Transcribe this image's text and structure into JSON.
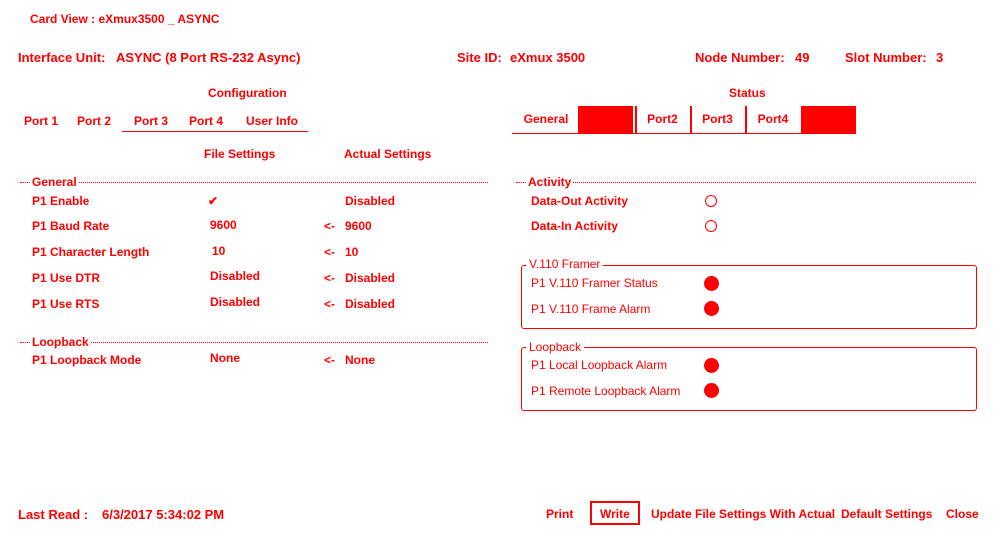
{
  "window": {
    "title": "Card View : eXmux3500 _ ASYNC"
  },
  "header": {
    "interface_unit_label": "Interface Unit:",
    "interface_unit_value": "ASYNC (8 Port RS-232 Async)",
    "site_id_label": "Site ID:",
    "site_id_value": "eXmux 3500",
    "node_number_label": "Node Number:",
    "node_number_value": "49",
    "slot_number_label": "Slot Number:",
    "slot_number_value": "3"
  },
  "configuration": {
    "title": "Configuration",
    "tabs": [
      "Port 1",
      "Port 2",
      "Port 3",
      "Port 4",
      "User Info"
    ],
    "col_file": "File Settings",
    "col_actual": "Actual Settings",
    "general_title": "General",
    "loopback_title": "Loopback",
    "rows": [
      {
        "label": "P1 Enable",
        "file": "",
        "actual": "Disabled",
        "arrow": ""
      },
      {
        "label": "P1 Baud Rate",
        "file": "9600",
        "actual": "9600",
        "arrow": "<-"
      },
      {
        "label": "P1 Character Length",
        "file": "10",
        "actual": "10",
        "arrow": "<-"
      },
      {
        "label": "P1 Use DTR",
        "file": "Disabled",
        "actual": "Disabled",
        "arrow": "<-"
      },
      {
        "label": "P1 Use RTS",
        "file": "Disabled",
        "actual": "Disabled",
        "arrow": "<-"
      }
    ],
    "loopback_row": {
      "label": "P1 Loopback Mode",
      "file": "None",
      "actual": "None",
      "arrow": "<-"
    }
  },
  "status": {
    "title": "Status",
    "tabs": [
      "General",
      "",
      "Port2",
      "Port3",
      "Port4",
      ""
    ],
    "activity_title": "Activity",
    "activity_rows": [
      "Data-Out Activity",
      "Data-In Activity"
    ],
    "v110_title": "V.110 Framer",
    "v110_rows": [
      "P1 V.110 Framer Status",
      "P1 V.110 Frame Alarm"
    ],
    "loopback_title": "Loopback",
    "loopback_rows": [
      "P1 Local Loopback Alarm",
      "P1 Remote Loopback Alarm"
    ]
  },
  "footer": {
    "last_read_label": "Last Read :",
    "last_read_value": "6/3/2017 5:34:02 PM",
    "buttons": [
      "Print",
      "Write",
      "Update File Settings With Actual",
      "Default Settings",
      "Close"
    ]
  },
  "colors": {
    "accent": "#ff0000",
    "background": "#ffffff"
  }
}
